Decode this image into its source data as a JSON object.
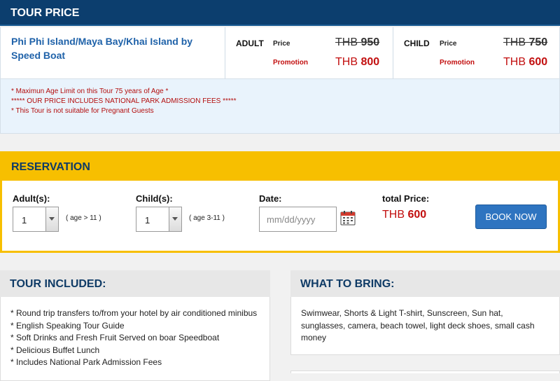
{
  "tour_price": {
    "header": "TOUR PRICE",
    "tour_name": "Phi Phi Island/Maya Bay/Khai Island by Speed Boat",
    "adult": {
      "label": "ADULT",
      "price_label": "Price",
      "promotion_label": "Promotion",
      "currency": "THB",
      "price": "950",
      "promotion": "800"
    },
    "child": {
      "label": "CHILD",
      "price_label": "Price",
      "promotion_label": "Promotion",
      "currency": "THB",
      "price": "750",
      "promotion": "600"
    },
    "notes": [
      "* Maximun Age Limit on this Tour 75 years of Age *",
      "***** OUR PRICE INCLUDES NATIONAL PARK ADMISSION FEES *****",
      "* This Tour is not suitable for Pregnant Guests"
    ]
  },
  "reservation": {
    "header": "RESERVATION",
    "adults_label": "Adult(s):",
    "adults_value": "1",
    "adults_hint": "( age > 11 )",
    "children_label": "Child(s):",
    "children_value": "1",
    "children_hint": "( age 3-11 )",
    "date_label": "Date:",
    "date_placeholder": "mm/dd/yyyy",
    "total_label": "total Price:",
    "total_currency": "THB",
    "total_value": "600",
    "book_button": "BOOK NOW"
  },
  "tour_included": {
    "title": "TOUR INCLUDED:",
    "items": [
      "* Round trip transfers to/from your hotel by air conditioned minibus",
      "* English Speaking Tour Guide",
      "* Soft Drinks and Fresh Fruit Served on boar Speedboat",
      "* Delicious Buffet Lunch",
      "* Includes National Park Admission Fees"
    ]
  },
  "what_to_bring": {
    "title": "WHAT TO BRING:",
    "text": "Swimwear, Shorts & Light T-shirt, Sunscreen, Sun hat, sunglasses, camera, beach towel, light deck shoes, small cash money"
  },
  "colors": {
    "navy": "#0c3e6e",
    "link_blue": "#1f62a9",
    "promo_red": "#c20f0f",
    "reservation_yellow": "#f7bf00",
    "button_blue": "#2e74c0"
  },
  "icons": {
    "calendar": "calendar-icon",
    "dropdown": "chevron-down-icon"
  }
}
